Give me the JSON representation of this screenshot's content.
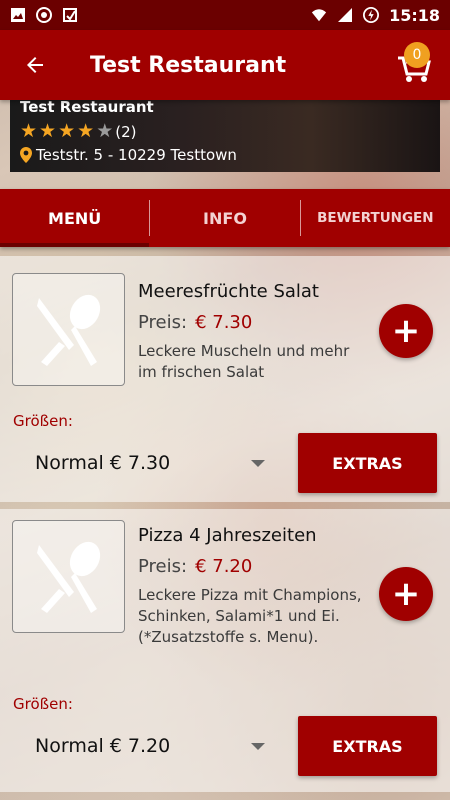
{
  "status_bar": {
    "time": "15:18",
    "left_icons": [
      "image-icon",
      "record-icon",
      "app-icon"
    ],
    "right_icons": [
      "wifi-icon",
      "signal-icon",
      "battery-icon"
    ]
  },
  "app_bar": {
    "title": "Test Restaurant",
    "cart_count": "0",
    "color": "#a00000"
  },
  "restaurant": {
    "name": "Test Restaurant",
    "stars_filled": 4,
    "stars_total": 5,
    "rating_count": "(2)",
    "address": "Teststr. 5 - 10229 Testtown"
  },
  "tabs": [
    {
      "label": "MENÜ",
      "active": true
    },
    {
      "label": "INFO",
      "active": false
    },
    {
      "label": "BEWERTUNGEN",
      "active": false
    }
  ],
  "items": [
    {
      "name": "Meeresfrüchte Salat",
      "price_label": "Preis:",
      "price": "€ 7.30",
      "description": "Leckere Muscheln und mehr im frischen Salat",
      "sizes_label": "Größen:",
      "size_value": "Normal € 7.30",
      "extras_label": "EXTRAS"
    },
    {
      "name": "Pizza 4 Jahreszeiten",
      "price_label": "Preis:",
      "price": "€ 7.20",
      "description": "Leckere Pizza mit Champions, Schinken, Salami*1 und Ei. (*Zusatzstoffe s. Menu).",
      "sizes_label": "Größen:",
      "size_value": "Normal € 7.20",
      "extras_label": "EXTRAS"
    }
  ]
}
